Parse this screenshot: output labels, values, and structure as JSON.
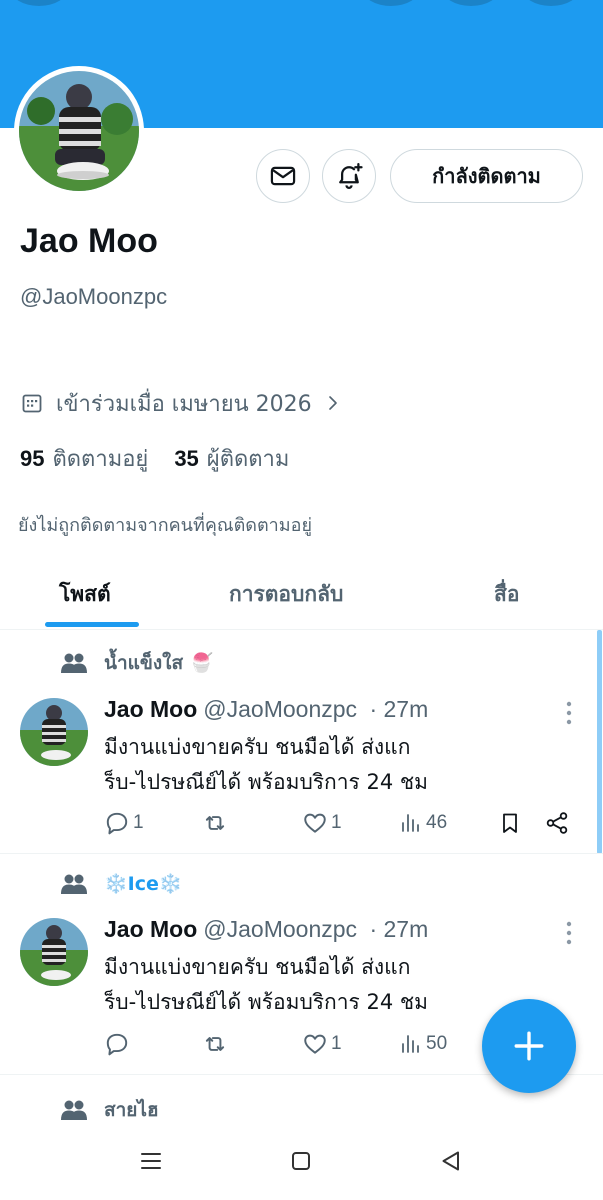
{
  "profile": {
    "name": "Jao Moo",
    "handle": "@JaoMoonzpc",
    "follow_button_label": "กำลังติดตาม",
    "joined": "เข้าร่วมเมื่อ เมษายน 2026",
    "following_count": "95",
    "following_label": "ติดตามอยู่",
    "followers_count": "35",
    "followers_label": "ผู้ติดตาม",
    "not_followed_text": "ยังไม่ถูกติดตามจากคนที่คุณติดตามอยู่"
  },
  "tabs": [
    {
      "label": "โพสต์",
      "active": true
    },
    {
      "label": "การตอบกลับ",
      "active": false
    },
    {
      "label": "สื่อ",
      "active": false
    }
  ],
  "posts": [
    {
      "community": "น้ำแข็งใส 🍧",
      "author": "Jao Moo",
      "handle": "@JaoMoonzpc",
      "time": "· 27m",
      "line1": "มีงานแบ่งขายครับ ชนมือได้ ส่งแก",
      "line2": "ร็บ-ไปรษณีย์ได้ พร้อมบริการ 24 ชม",
      "replies": "1",
      "reposts": "",
      "likes": "1",
      "views": "46"
    },
    {
      "community": "❄️Ice❄️",
      "author": "Jao Moo",
      "handle": "@JaoMoonzpc",
      "time": "· 27m",
      "line1": "มีงานแบ่งขายครับ  ชนมือได้ ส่งแก",
      "line2": "ร็บ-ไปรษณีย์ได้ พร้อมบริการ 24 ชม",
      "replies": "",
      "reposts": "",
      "likes": "1",
      "views": "50"
    },
    {
      "community": "สายไฮ"
    }
  ],
  "colors": {
    "accent": "#1d9bf0",
    "text_primary": "#0f1419",
    "text_secondary": "#536471",
    "border": "#cfd9de"
  },
  "icons": {
    "message": "envelope-icon",
    "notify": "bell-plus-icon",
    "calendar": "calendar-icon",
    "community": "people-icon",
    "reply": "speech-bubble-icon",
    "repost": "repost-arrows-icon",
    "like": "heart-icon",
    "views": "bar-chart-icon",
    "bookmark": "bookmark-icon",
    "share": "share-icon",
    "compose": "plus-icon"
  }
}
